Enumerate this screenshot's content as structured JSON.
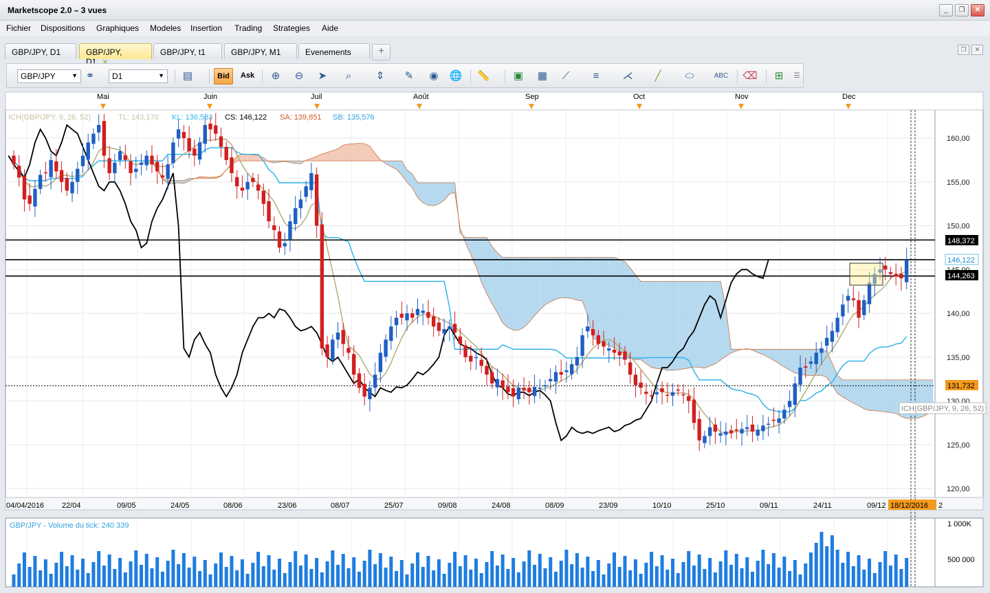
{
  "app": {
    "title": "Marketscope 2.0 – 3 vues"
  },
  "window_buttons": {
    "minimize": "_",
    "restore": "❐",
    "close": "✕"
  },
  "menu": [
    "Fichier",
    "Dispositions",
    "Graphiques",
    "Modeles",
    "Insertion",
    "Trading",
    "Strategies",
    "Aide"
  ],
  "tabs": [
    {
      "label": "GBP/JPY, D1",
      "active": false
    },
    {
      "label": "GBP/JPY, D1",
      "active": true
    },
    {
      "label": "GBP/JPY, t1",
      "active": false
    },
    {
      "label": "GBP/JPY, M1",
      "active": false
    },
    {
      "label": "Evenements",
      "active": false
    }
  ],
  "tab_close": "✕",
  "tab_add": "+",
  "toolbar": {
    "symbol": "GBP/JPY",
    "timeframe": "D1",
    "bid_label": "Bid",
    "ask_label": "Ask"
  },
  "indicator_line": {
    "name": "ICH(GBP/JPY, 9, 26, 52)",
    "tl": "TL: 143,170",
    "kl": "KL: 136,533",
    "cs": "CS: 146,122",
    "sa": "SA: 139,851",
    "sb": "SB: 135,576"
  },
  "month_labels": [
    "Mai",
    "Juin",
    "Juil",
    "Août",
    "Sep",
    "Oct",
    "Nov",
    "Dec"
  ],
  "date_labels": [
    "04/04/2016",
    "22/04",
    "09/05",
    "24/05",
    "08/06",
    "23/06",
    "08/07",
    "25/07",
    "09/08",
    "24/08",
    "08/09",
    "23/09",
    "10/10",
    "25/10",
    "09/11",
    "24/11",
    "09/12"
  ],
  "date_highlight": "18/12/2016",
  "date_tail": "2",
  "price_axis": [
    "160,00",
    "155,00",
    "150,00",
    "145,00",
    "140,00",
    "135,00",
    "130,00",
    "125,00",
    "120,00"
  ],
  "price_tags": {
    "level1": "148,372",
    "current": "146,122",
    "level2": "144,263",
    "dotted": "131,732"
  },
  "ich_tag": "ICH(GBP/JPY, 9, 26, 52)",
  "volume": {
    "title": "GBP/JPY - Volume du tick: 240 339",
    "axis": [
      "1 000K",
      "500 000"
    ]
  },
  "colors": {
    "bull": "#1f5fc4",
    "bear": "#d21f1f",
    "cloud_up": "#f2c1ac",
    "cloud_down": "#a9d2ec",
    "tenkan": "#b5ad7c",
    "kijun": "#31b5ea",
    "chikou": "#000000",
    "volume": "#1e7de0",
    "highlight": "#f49a1e"
  },
  "chart_data": {
    "type": "candlestick",
    "symbol": "GBP/JPY",
    "timeframe": "D1",
    "ylim": [
      119,
      163
    ],
    "horizontal_lines": [
      148.372,
      146.122,
      144.263
    ],
    "dotted_line": 131.732,
    "closes": [
      157.0,
      155.5,
      153.0,
      152.5,
      154.2,
      155.8,
      156.0,
      157.5,
      156.2,
      155.0,
      154.0,
      155.0,
      156.5,
      158.0,
      159.5,
      160.5,
      161.5,
      158.0,
      156.0,
      157.2,
      158.5,
      157.5,
      156.0,
      156.5,
      157.2,
      158.0,
      157.0,
      156.2,
      155.5,
      157.0,
      159.5,
      161.0,
      160.0,
      158.5,
      158.0,
      159.5,
      161.5,
      161.0,
      160.5,
      159.0,
      157.5,
      156.0,
      154.5,
      154.0,
      155.0,
      155.0,
      154.0,
      152.5,
      150.5,
      149.5,
      147.5,
      148.0,
      150.5,
      152.0,
      153.0,
      154.5,
      156.0,
      150.0,
      136.0,
      135.0,
      137.0,
      137.8,
      136.5,
      135.5,
      133.0,
      131.5,
      130.5,
      131.5,
      133.0,
      135.5,
      137.0,
      138.5,
      139.5,
      139.5,
      140.0,
      139.5,
      140.5,
      140.3,
      139.5,
      138.5,
      138.0,
      138.2,
      138.5,
      137.8,
      136.5,
      135.0,
      134.5,
      135.0,
      134.0,
      133.0,
      132.0,
      132.5,
      131.5,
      131.0,
      130.5,
      131.5,
      131.2,
      131.0,
      131.6,
      131.5,
      131.8,
      132.5,
      133.3,
      133.0,
      133.5,
      134.2,
      135.0,
      137.5,
      138.5,
      137.5,
      136.5,
      136.2,
      136.0,
      135.5,
      135.2,
      134.7,
      133.0,
      131.8,
      131.5,
      130.8,
      130.6,
      131.0,
      131.0,
      130.6,
      131.0,
      131.2,
      130.7,
      130.0,
      127.5,
      125.5,
      126.0,
      127.0,
      126.5,
      126.3,
      126.5,
      126.3,
      126.6,
      126.8,
      127.0,
      126.5,
      126.7,
      127.2,
      127.4,
      127.8,
      128.0,
      129.0,
      130.0,
      132.0,
      133.8,
      133.8,
      134.5,
      135.5,
      136.0,
      137.2,
      138.0,
      139.5,
      141.0,
      142.0,
      141.5,
      139.5,
      141.5,
      143.5,
      144.5,
      145.0,
      145.0,
      144.5,
      144.2,
      144.0,
      146.1
    ]
  }
}
